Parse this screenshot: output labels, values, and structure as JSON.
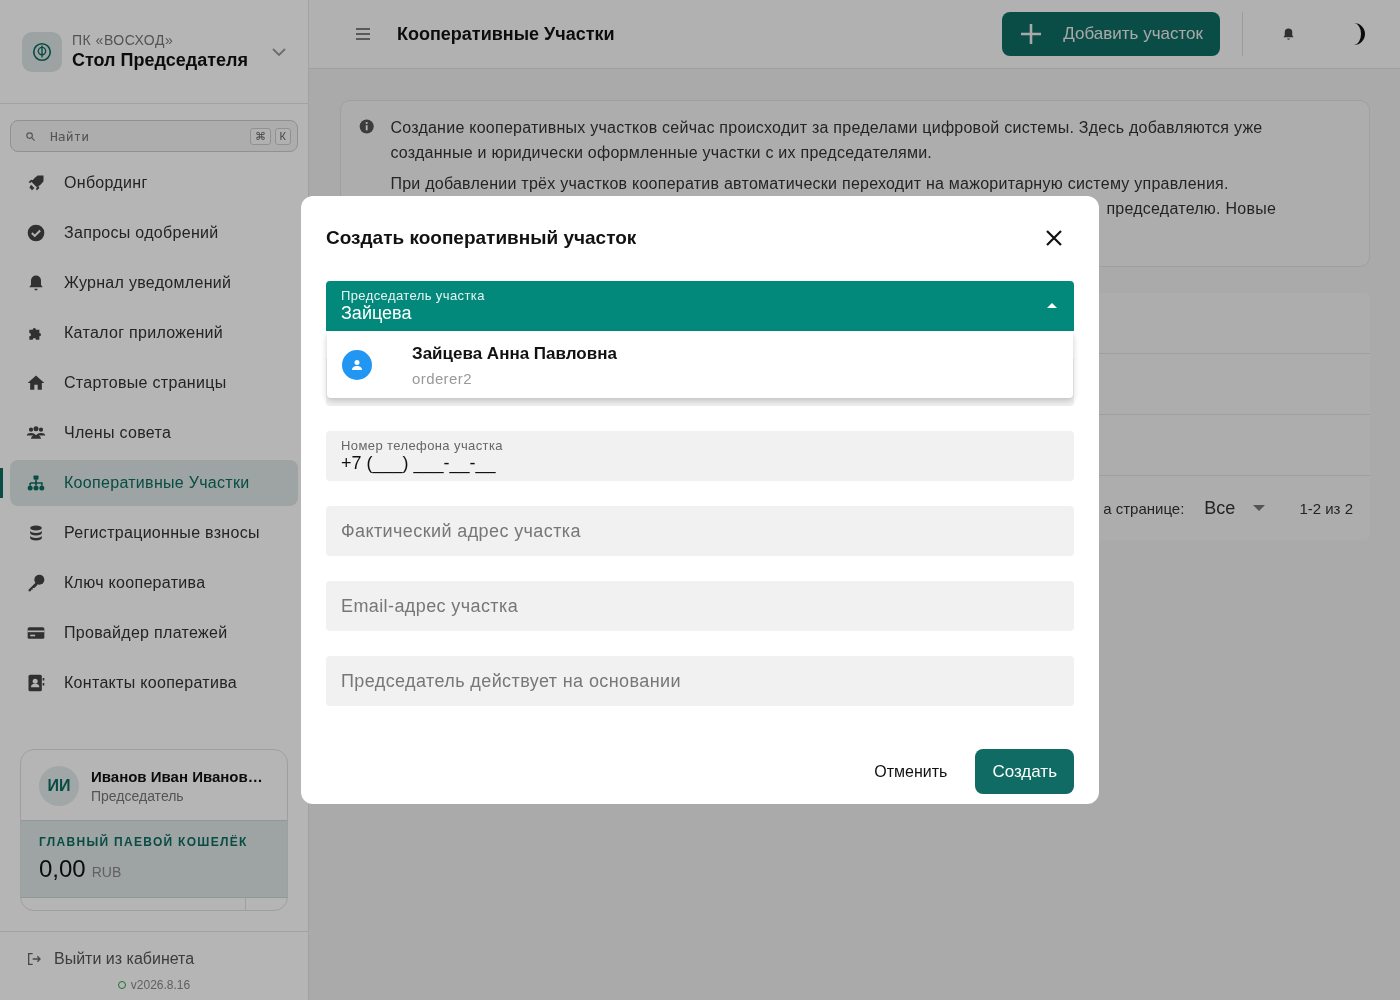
{
  "sidebar": {
    "org": "ПК «ВОСХОД»",
    "title": "Стол Председателя",
    "search": {
      "placeholder": "Найти",
      "shortcut": [
        "⌘",
        "К"
      ]
    },
    "items": [
      {
        "label": "Онбординг",
        "selected": false
      },
      {
        "label": "Запросы одобрений",
        "selected": false
      },
      {
        "label": "Журнал уведомлений",
        "selected": false
      },
      {
        "label": "Каталог приложений",
        "selected": false
      },
      {
        "label": "Стартовые страницы",
        "selected": false
      },
      {
        "label": "Члены совета",
        "selected": false
      },
      {
        "label": "Кооперативные Участки",
        "selected": true
      },
      {
        "label": "Регистрационные взносы",
        "selected": false
      },
      {
        "label": "Ключ кооператива",
        "selected": false
      },
      {
        "label": "Провайдер платежей",
        "selected": false
      },
      {
        "label": "Контакты кооператива",
        "selected": false
      }
    ],
    "user": {
      "initials": "ИИ",
      "name": "Иванов Иван Иванов…",
      "role": "Председатель"
    },
    "wallet": {
      "label": "ГЛАВНЫЙ ПАЕВОЙ КОШЕЛЁК",
      "amount": "0,00",
      "currency": "RUB"
    },
    "logout": "Выйти из кабинета",
    "version": "v2026.8.16"
  },
  "topbar": {
    "title": "Кооперативные Участки",
    "add_button": "Добавить участок"
  },
  "info": {
    "paragraph": "Создание кооперативных участков сейчас происходит за пределами цифровой системы. Здесь добавляются уже созданные и юридически оформленные участки с их председателями.",
    "line_2": "При добавлении трёх участков кооператив автоматически переходит на мажоритарную систему управления.",
    "line_3_fragment": "председателю. Новые"
  },
  "table": {
    "footer": {
      "per_page_label": "а странице:",
      "per_page": "Все",
      "range": "1-2 из 2"
    }
  },
  "dialog": {
    "title": "Создать кооперативный участок",
    "fields": [
      {
        "kind": "select",
        "label": "Председатель участка",
        "value": "Зайцева",
        "expanded": true,
        "options": [
          {
            "name": "Зайцева Анна Павловна",
            "sub": "orderer2"
          }
        ]
      },
      {
        "kind": "text",
        "label": "Номер телефона участка",
        "value": "+7 (___) ___-__-__"
      },
      {
        "kind": "text",
        "placeholder": "Фактический адрес участка"
      },
      {
        "kind": "text",
        "placeholder": "Email-адрес участка"
      },
      {
        "kind": "text",
        "placeholder": "Председатель действует на основании"
      }
    ],
    "cancel": "Отменить",
    "submit": "Создать"
  }
}
